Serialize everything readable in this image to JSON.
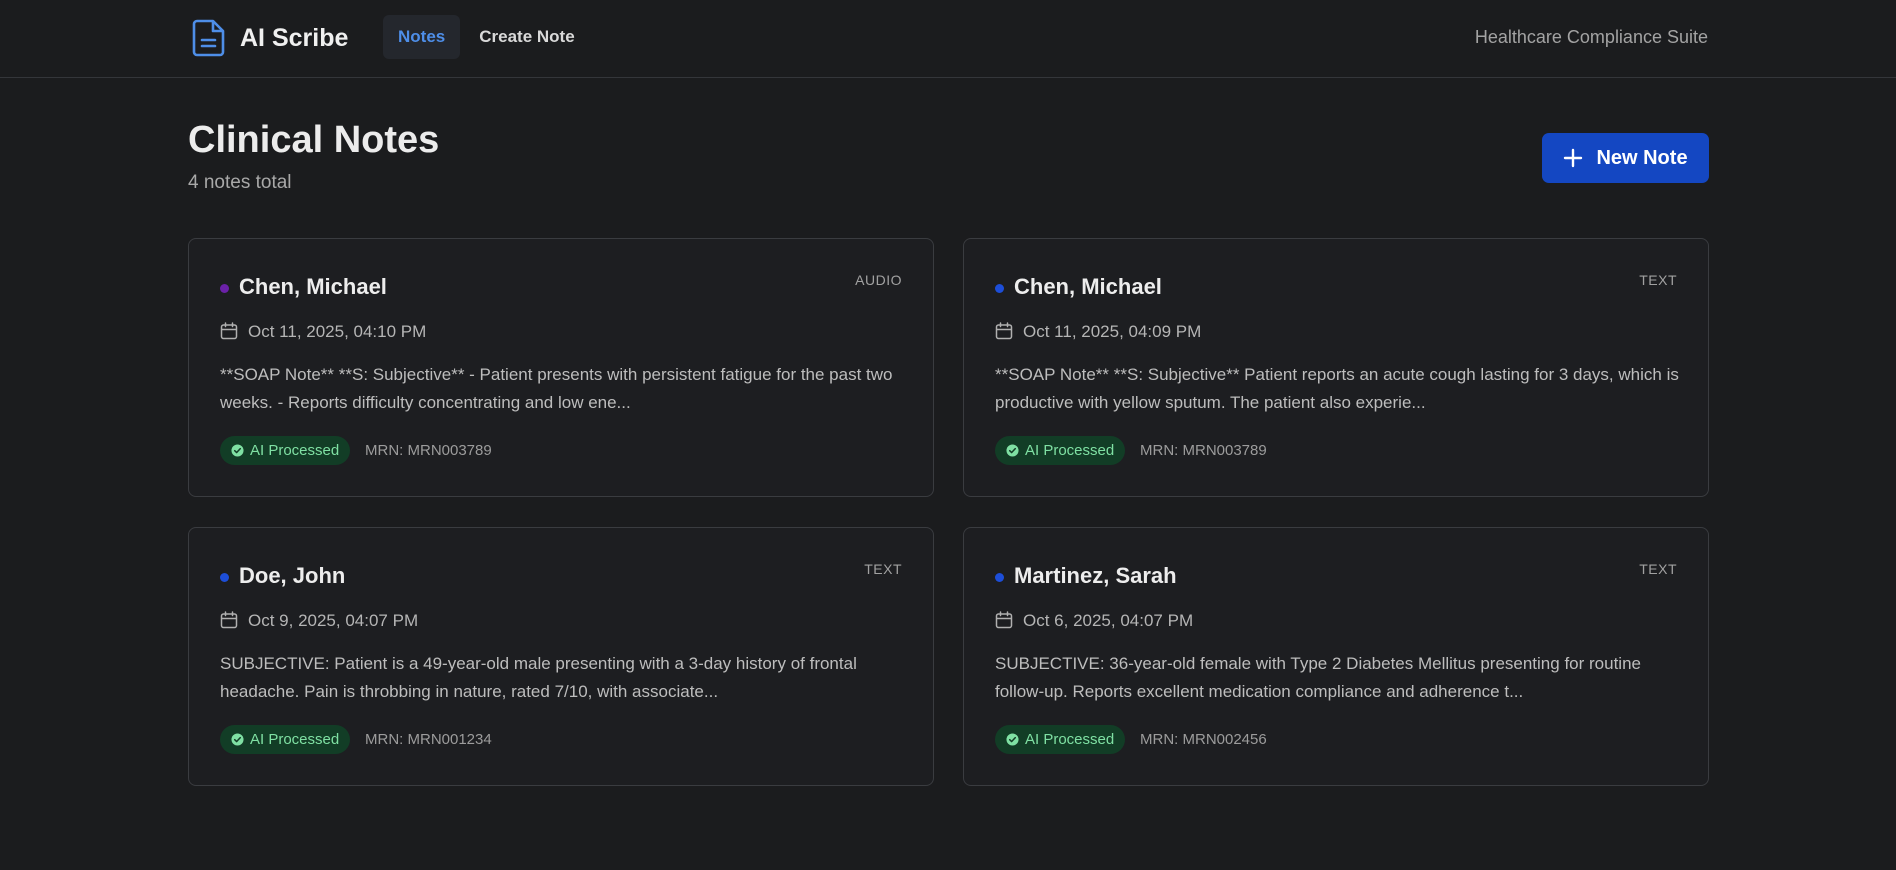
{
  "app": {
    "name": "AI Scribe",
    "suite": "Healthcare Compliance Suite"
  },
  "nav": {
    "items": [
      {
        "label": "Notes",
        "active": true
      },
      {
        "label": "Create Note",
        "active": false
      }
    ]
  },
  "page": {
    "title": "Clinical Notes",
    "subtitle": "4 notes total",
    "new_button": "New Note"
  },
  "notes": [
    {
      "patient": "Chen, Michael",
      "type": "AUDIO",
      "dot_color": "#6b21a8",
      "date": "Oct 11, 2025, 04:10 PM",
      "preview": "**SOAP Note** **S: Subjective** - Patient presents with persistent fatigue for the past two weeks. - Reports difficulty concentrating and low ene...",
      "status": "AI Processed",
      "mrn": "MRN: MRN003789"
    },
    {
      "patient": "Chen, Michael",
      "type": "TEXT",
      "dot_color": "#1d4ed8",
      "date": "Oct 11, 2025, 04:09 PM",
      "preview": "**SOAP Note** **S: Subjective** Patient reports an acute cough lasting for 3 days, which is productive with yellow sputum. The patient also experie...",
      "status": "AI Processed",
      "mrn": "MRN: MRN003789"
    },
    {
      "patient": "Doe, John",
      "type": "TEXT",
      "dot_color": "#1d4ed8",
      "date": "Oct 9, 2025, 04:07 PM",
      "preview": "SUBJECTIVE: Patient is a 49-year-old male presenting with a 3-day history of frontal headache. Pain is throbbing in nature, rated 7/10, with associate...",
      "status": "AI Processed",
      "mrn": "MRN: MRN001234"
    },
    {
      "patient": "Martinez, Sarah",
      "type": "TEXT",
      "dot_color": "#1d4ed8",
      "date": "Oct 6, 2025, 04:07 PM",
      "preview": "SUBJECTIVE: 36-year-old female with Type 2 Diabetes Mellitus presenting for routine follow-up. Reports excellent medication compliance and adherence t...",
      "status": "AI Processed",
      "mrn": "MRN: MRN002456"
    }
  ],
  "colors": {
    "accent": "#1447c2",
    "nav_active": "#4e8ee8",
    "badge_bg": "#123d26",
    "badge_text": "#7fe0a3"
  }
}
